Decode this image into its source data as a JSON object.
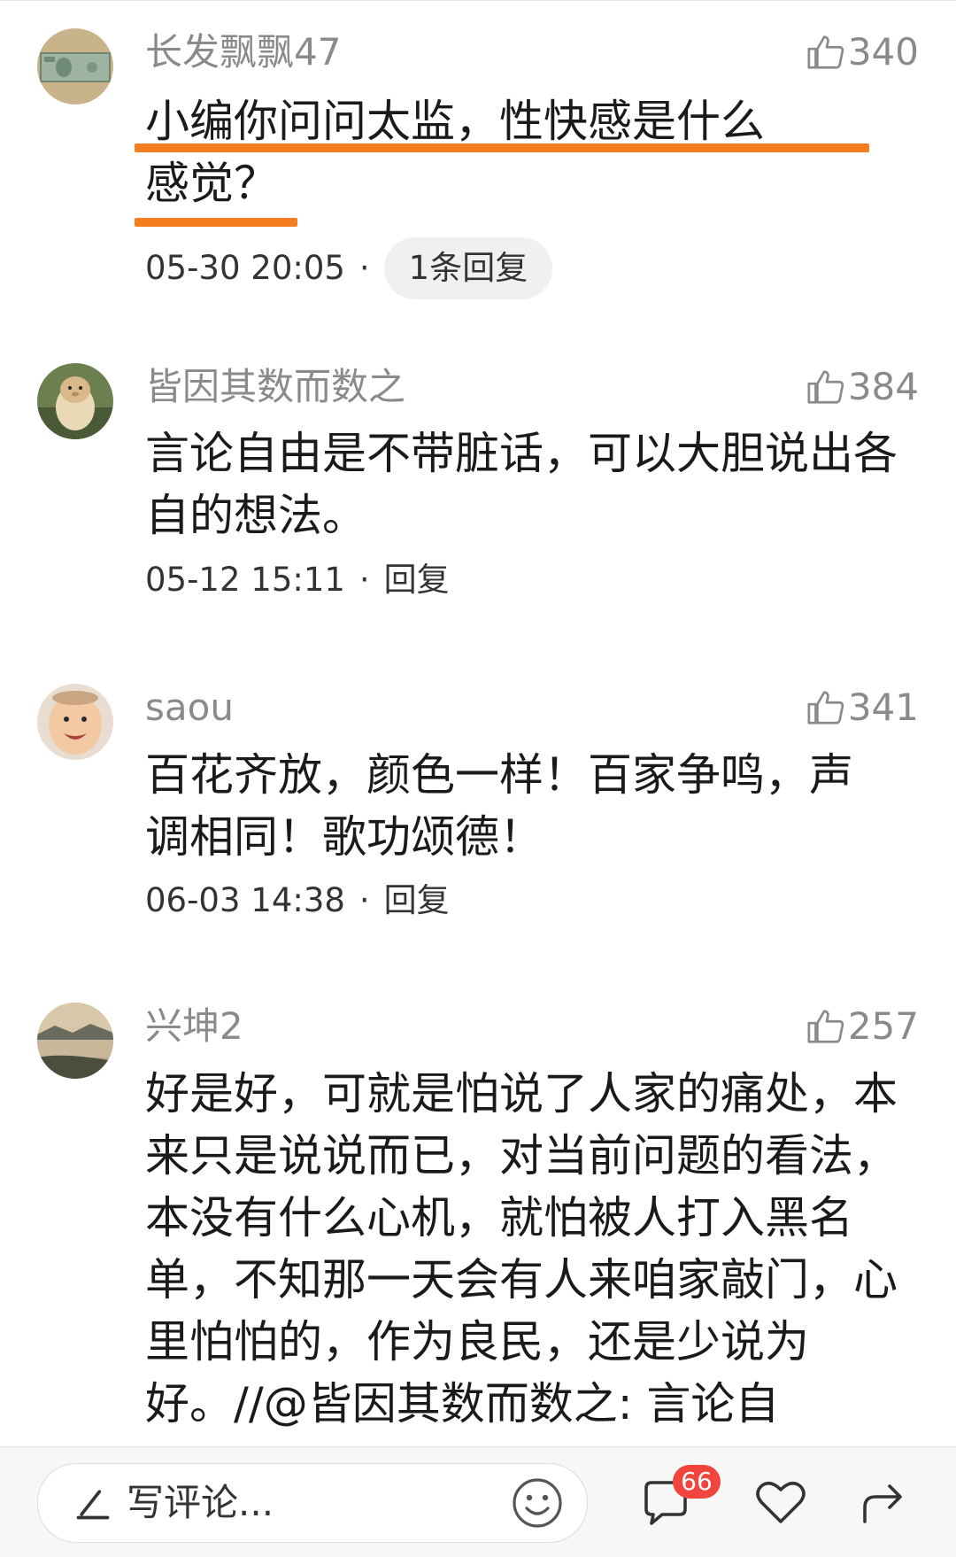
{
  "comments": [
    {
      "username": "长发飘飘47",
      "likes": "340",
      "text": "小编你问问太监，性快感是什么感觉？",
      "time": "05-30 20:05",
      "reply": "1条回复",
      "avatar_icon": "money-bill-avatar"
    },
    {
      "username": "皆因其数而数之",
      "likes": "384",
      "text": "言论自由是不带脏话，可以大胆说出各自的想法。",
      "time": "05-12 15:11",
      "reply": "回复",
      "avatar_icon": "hamster-avatar"
    },
    {
      "username": "saou",
      "likes": "341",
      "text": "百花齐放，颜色一样！百家争鸣，声调相同！歌功颂德！",
      "time": "06-03 14:38",
      "reply": "回复",
      "avatar_icon": "baby-face-avatar"
    },
    {
      "username": "兴坤2",
      "likes": "257",
      "text": "好是好，可就是怕说了人家的痛处，本来只是说说而已，对当前问题的看法，本没有什么心机，就怕被人打入黑名单，不知那一天会有人来咱家敲门，心里怕怕的，作为良民，还是少说为好。//@皆因其数而数之: 言论自",
      "avatar_icon": "lake-landscape-avatar"
    }
  ],
  "bottom_bar": {
    "comment_placeholder": "写评论...",
    "comment_count_badge": "66",
    "icons": [
      "pen-icon",
      "emoji-icon",
      "comment-icon",
      "heart-icon",
      "share-icon"
    ]
  },
  "colors": {
    "highlight_underline": "#f57d1f",
    "badge": "#f0443d",
    "muted_text": "#8a8a8a"
  }
}
